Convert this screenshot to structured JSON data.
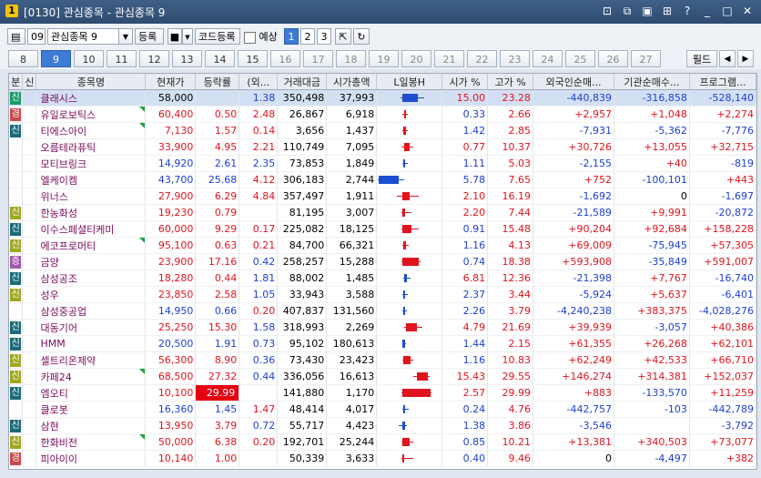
{
  "window": {
    "title": "[0130] 관심종목 - 관심종목 9",
    "app_badge": "1"
  },
  "toolbar": {
    "group_no": "09",
    "group_name": "관심종목 9",
    "register_label": "등록",
    "code_register_label": "코드등록",
    "forecast_label": "예상",
    "pages": [
      "1",
      "2",
      "3"
    ]
  },
  "tabs": [
    "8",
    "9",
    "10",
    "11",
    "12",
    "13",
    "14",
    "15",
    "16",
    "17",
    "18",
    "19",
    "20",
    "21",
    "22",
    "23",
    "24",
    "25",
    "26",
    "27"
  ],
  "active_tab": "9",
  "filter_label": "필드",
  "columns": [
    "분",
    "신",
    "종목명",
    "현재가",
    "등락률",
    "(외...",
    "거래대금",
    "시가총액",
    "L일봉H",
    "시가 %",
    "고가 %",
    "외국인순매...",
    "기관순매수...",
    "프로그램..."
  ],
  "colors": {
    "up": "#e0141e",
    "down": "#1c3fd6",
    "accent": "#3d7bd6"
  },
  "rows": [
    {
      "b": "신",
      "bc": "g",
      "name": "클래시스",
      "price": "58,000",
      "pc": "k",
      "chg": "",
      "cc": "k",
      "fr": "1.38",
      "fc": "b",
      "vol": "350,498",
      "cap": "37,993",
      "open": "15.00",
      "oc": "r",
      "high": "23.28",
      "hc": "r",
      "frn": "-440,839",
      "frc": "b",
      "inst": "-316,858",
      "ic": "b",
      "prog": "-528,140",
      "prc": "b",
      "flag": false,
      "candle": {
        "l": 26,
        "h": 52,
        "o": 28,
        "c": 45,
        "dir": "d"
      },
      "sel": true
    },
    {
      "b": "경",
      "bc": "r",
      "name": "유일로보틱스",
      "price": "60,400",
      "pc": "r",
      "chg": "0.50",
      "cc": "r",
      "fr": "2.48",
      "fc": "r",
      "vol": "26,867",
      "cap": "6,918",
      "open": "0.33",
      "oc": "b",
      "high": "2.66",
      "hc": "r",
      "frn": "+2,957",
      "frc": "r",
      "inst": "+1,048",
      "ic": "r",
      "prog": "+2,274",
      "prc": "r",
      "flag": true,
      "candle": {
        "l": 28,
        "h": 34,
        "o": 30,
        "c": 31,
        "dir": "u"
      }
    },
    {
      "b": "신",
      "bc": "t",
      "name": "티에스아이",
      "price": "7,130",
      "pc": "r",
      "chg": "1.57",
      "cc": "r",
      "fr": "0.14",
      "fc": "r",
      "vol": "3,656",
      "cap": "1,437",
      "open": "1.42",
      "oc": "b",
      "high": "2.85",
      "hc": "r",
      "frn": "-7,931",
      "frc": "b",
      "inst": "-5,362",
      "ic": "b",
      "prog": "-7,776",
      "prc": "b",
      "flag": true,
      "candle": {
        "l": 28,
        "h": 34,
        "o": 29,
        "c": 32,
        "dir": "u"
      }
    },
    {
      "b": "",
      "bc": "",
      "name": "오름테라퓨틱",
      "price": "33,900",
      "pc": "r",
      "chg": "4.95",
      "cc": "r",
      "fr": "2.21",
      "fc": "r",
      "vol": "110,749",
      "cap": "7,095",
      "open": "0.77",
      "oc": "r",
      "high": "10.37",
      "hc": "r",
      "frn": "+30,726",
      "frc": "r",
      "inst": "+13,055",
      "ic": "r",
      "prog": "+32,715",
      "prc": "r",
      "flag": false,
      "candle": {
        "l": 27,
        "h": 40,
        "o": 30,
        "c": 36,
        "dir": "u"
      }
    },
    {
      "b": "",
      "bc": "",
      "name": "모티브링크",
      "price": "14,920",
      "pc": "b",
      "chg": "2.61",
      "cc": "b",
      "fr": "2.35",
      "fc": "b",
      "vol": "73,853",
      "cap": "1,849",
      "open": "1.11",
      "oc": "b",
      "high": "5.03",
      "hc": "r",
      "frn": "-2,155",
      "frc": "b",
      "inst": "+40",
      "ic": "r",
      "prog": "-819",
      "prc": "b",
      "flag": false,
      "candle": {
        "l": 28,
        "h": 34,
        "o": 29,
        "c": 31,
        "dir": "d"
      }
    },
    {
      "b": "",
      "bc": "",
      "name": "엘케이켐",
      "price": "43,700",
      "pc": "b",
      "chg": "25.68",
      "cc": "b",
      "fr": "4.12",
      "fc": "r",
      "vol": "306,183",
      "cap": "2,744",
      "open": "5.78",
      "oc": "b",
      "high": "7.65",
      "hc": "r",
      "frn": "+752",
      "frc": "r",
      "inst": "-100,101",
      "ic": "b",
      "prog": "+443",
      "prc": "r",
      "flag": false,
      "candle": {
        "l": 1,
        "h": 30,
        "o": 2,
        "c": 24,
        "dir": "d"
      }
    },
    {
      "b": "",
      "bc": "",
      "name": "위너스",
      "price": "27,900",
      "pc": "r",
      "chg": "6.29",
      "cc": "r",
      "fr": "4.84",
      "fc": "r",
      "vol": "357,497",
      "cap": "1,911",
      "open": "2.10",
      "oc": "r",
      "high": "16.19",
      "hc": "r",
      "frn": "-1,692",
      "frc": "b",
      "inst": "0",
      "ic": "k",
      "prog": "-1,697",
      "prc": "b",
      "flag": false,
      "candle": {
        "l": 22,
        "h": 46,
        "o": 28,
        "c": 36,
        "dir": "u"
      }
    },
    {
      "b": "신",
      "bc": "y",
      "name": "한농화성",
      "price": "19,230",
      "pc": "r",
      "chg": "0.79",
      "cc": "r",
      "fr": "",
      "fc": "k",
      "vol": "81,195",
      "cap": "3,007",
      "open": "2.20",
      "oc": "r",
      "high": "7.44",
      "hc": "r",
      "frn": "-21,589",
      "frc": "b",
      "inst": "+9,991",
      "ic": "r",
      "prog": "-20,872",
      "prc": "b",
      "flag": false,
      "candle": {
        "l": 27,
        "h": 38,
        "o": 28,
        "c": 31,
        "dir": "u"
      }
    },
    {
      "b": "신",
      "bc": "t",
      "name": "이수스페셜티케미",
      "price": "60,000",
      "pc": "r",
      "chg": "9.29",
      "cc": "r",
      "fr": "0.17",
      "fc": "r",
      "vol": "225,082",
      "cap": "18,125",
      "open": "0.91",
      "oc": "b",
      "high": "15.48",
      "hc": "r",
      "frn": "+90,204",
      "frc": "r",
      "inst": "+92,684",
      "ic": "r",
      "prog": "+158,228",
      "prc": "r",
      "flag": false,
      "candle": {
        "l": 27,
        "h": 46,
        "o": 28,
        "c": 38,
        "dir": "u"
      }
    },
    {
      "b": "신",
      "bc": "y",
      "name": "에코프로머티",
      "price": "95,100",
      "pc": "r",
      "chg": "0.63",
      "cc": "r",
      "fr": "0.21",
      "fc": "r",
      "vol": "84,700",
      "cap": "66,321",
      "open": "1.16",
      "oc": "b",
      "high": "4.13",
      "hc": "r",
      "frn": "+69,009",
      "frc": "r",
      "inst": "-75,945",
      "ic": "b",
      "prog": "+57,305",
      "prc": "r",
      "flag": true,
      "candle": {
        "l": 28,
        "h": 35,
        "o": 29,
        "c": 32,
        "dir": "u"
      }
    },
    {
      "b": "증",
      "bc": "p",
      "name": "금양",
      "price": "23,900",
      "pc": "r",
      "chg": "17.16",
      "cc": "r",
      "fr": "0.42",
      "fc": "b",
      "vol": "258,257",
      "cap": "15,288",
      "open": "0.74",
      "oc": "b",
      "high": "18.38",
      "hc": "r",
      "frn": "+593,908",
      "frc": "r",
      "inst": "-35,849",
      "ic": "b",
      "prog": "+591,007",
      "prc": "r",
      "flag": false,
      "candle": {
        "l": 27,
        "h": 48,
        "o": 28,
        "c": 46,
        "dir": "u"
      }
    },
    {
      "b": "신",
      "bc": "t",
      "name": "삼성공조",
      "price": "18,280",
      "pc": "r",
      "chg": "0.44",
      "cc": "r",
      "fr": "1.81",
      "fc": "b",
      "vol": "88,002",
      "cap": "1,485",
      "open": "6.81",
      "oc": "r",
      "high": "12.36",
      "hc": "r",
      "frn": "-21,398",
      "frc": "b",
      "inst": "+7,767",
      "ic": "r",
      "prog": "-16,740",
      "prc": "b",
      "flag": false,
      "candle": {
        "l": 29,
        "h": 37,
        "o": 30,
        "c": 33,
        "dir": "d"
      }
    },
    {
      "b": "신",
      "bc": "y",
      "name": "성우",
      "price": "23,850",
      "pc": "r",
      "chg": "2.58",
      "cc": "r",
      "fr": "1.05",
      "fc": "b",
      "vol": "33,943",
      "cap": "3,588",
      "open": "2.37",
      "oc": "b",
      "high": "3.44",
      "hc": "r",
      "frn": "-5,924",
      "frc": "b",
      "inst": "+5,637",
      "ic": "r",
      "prog": "-6,401",
      "prc": "b",
      "flag": false,
      "candle": {
        "l": 28,
        "h": 34,
        "o": 29,
        "c": 31,
        "dir": "d"
      }
    },
    {
      "b": "",
      "bc": "",
      "name": "삼성중공업",
      "price": "14,950",
      "pc": "b",
      "chg": "0.66",
      "cc": "b",
      "fr": "0.20",
      "fc": "r",
      "vol": "407,837",
      "cap": "131,560",
      "open": "2.26",
      "oc": "b",
      "high": "3.79",
      "hc": "r",
      "frn": "-4,240,238",
      "frc": "b",
      "inst": "+383,375",
      "ic": "r",
      "prog": "-4,028,276",
      "prc": "b",
      "flag": false,
      "candle": {
        "l": 28,
        "h": 33,
        "o": 29,
        "c": 31,
        "dir": "d"
      }
    },
    {
      "b": "신",
      "bc": "t",
      "name": "대동기어",
      "price": "25,250",
      "pc": "r",
      "chg": "15.30",
      "cc": "r",
      "fr": "1.58",
      "fc": "b",
      "vol": "318,993",
      "cap": "2,269",
      "open": "4.79",
      "oc": "r",
      "high": "21.69",
      "hc": "r",
      "frn": "+39,939",
      "frc": "r",
      "inst": "-3,057",
      "ic": "b",
      "prog": "+40,386",
      "prc": "r",
      "flag": false,
      "candle": {
        "l": 30,
        "h": 50,
        "o": 32,
        "c": 44,
        "dir": "u"
      }
    },
    {
      "b": "신",
      "bc": "t",
      "name": "HMM",
      "price": "20,500",
      "pc": "b",
      "chg": "1.91",
      "cc": "b",
      "fr": "0.73",
      "fc": "b",
      "vol": "95,102",
      "cap": "180,613",
      "open": "1.44",
      "oc": "b",
      "high": "2.15",
      "hc": "r",
      "frn": "+61,355",
      "frc": "r",
      "inst": "+26,268",
      "ic": "r",
      "prog": "+62,101",
      "prc": "r",
      "flag": false,
      "candle": {
        "l": 28,
        "h": 32,
        "o": 28,
        "c": 31,
        "dir": "d"
      }
    },
    {
      "b": "신",
      "bc": "y",
      "name": "셀트리온제약",
      "price": "56,300",
      "pc": "r",
      "chg": "8.90",
      "cc": "r",
      "fr": "0.36",
      "fc": "b",
      "vol": "73,430",
      "cap": "23,423",
      "open": "1.16",
      "oc": "b",
      "high": "10.83",
      "hc": "r",
      "frn": "+62,249",
      "frc": "r",
      "inst": "+42,533",
      "ic": "r",
      "prog": "+66,710",
      "prc": "r",
      "flag": false,
      "candle": {
        "l": 28,
        "h": 40,
        "o": 29,
        "c": 37,
        "dir": "u"
      }
    },
    {
      "b": "신",
      "bc": "y",
      "name": "카페24",
      "price": "68,500",
      "pc": "r",
      "chg": "27.32",
      "cc": "r",
      "fr": "0.44",
      "fc": "b",
      "vol": "336,056",
      "cap": "16,613",
      "open": "15.43",
      "oc": "r",
      "high": "29.55",
      "hc": "r",
      "frn": "+146,274",
      "frc": "r",
      "inst": "+314,381",
      "ic": "r",
      "prog": "+152,037",
      "prc": "r",
      "flag": true,
      "candle": {
        "l": 40,
        "h": 58,
        "o": 44,
        "c": 56,
        "dir": "u"
      }
    },
    {
      "b": "신",
      "bc": "t",
      "name": "엠오티",
      "price": "10,100",
      "pc": "r",
      "chg": "29.99",
      "cc": "h",
      "fr": "",
      "fc": "k",
      "vol": "141,880",
      "cap": "1,170",
      "open": "2.57",
      "oc": "r",
      "high": "29.99",
      "hc": "r",
      "frn": "+883",
      "frc": "r",
      "inst": "-133,570",
      "ic": "b",
      "prog": "+11,259",
      "prc": "r",
      "flag": false,
      "candle": {
        "l": 27,
        "h": 60,
        "o": 28,
        "c": 59,
        "dir": "u"
      }
    },
    {
      "b": "",
      "bc": "",
      "name": "클로봇",
      "price": "16,360",
      "pc": "b",
      "chg": "1.45",
      "cc": "b",
      "fr": "1.47",
      "fc": "r",
      "vol": "48,414",
      "cap": "4,017",
      "open": "0.24",
      "oc": "b",
      "high": "4.76",
      "hc": "r",
      "frn": "-442,757",
      "frc": "b",
      "inst": "-103",
      "ic": "b",
      "prog": "-442,789",
      "prc": "b",
      "flag": false,
      "candle": {
        "l": 28,
        "h": 35,
        "o": 29,
        "c": 31,
        "dir": "d"
      }
    },
    {
      "b": "신",
      "bc": "t",
      "name": "삼현",
      "price": "13,950",
      "pc": "r",
      "chg": "3.79",
      "cc": "r",
      "fr": "0.72",
      "fc": "b",
      "vol": "55,717",
      "cap": "4,423",
      "open": "1.38",
      "oc": "b",
      "high": "3.86",
      "hc": "r",
      "frn": "-3,546",
      "frc": "b",
      "inst": "",
      "ic": "k",
      "prog": "-3,792",
      "prc": "b",
      "flag": false,
      "candle": {
        "l": 24,
        "h": 33,
        "o": 28,
        "c": 31,
        "dir": "d"
      }
    },
    {
      "b": "신",
      "bc": "y",
      "name": "한화비전",
      "price": "50,000",
      "pc": "r",
      "chg": "6.38",
      "cc": "r",
      "fr": "0.20",
      "fc": "r",
      "vol": "192,701",
      "cap": "25,244",
      "open": "0.85",
      "oc": "b",
      "high": "10.21",
      "hc": "r",
      "frn": "+13,381",
      "frc": "r",
      "inst": "+340,503",
      "ic": "r",
      "prog": "+73,077",
      "prc": "r",
      "flag": true,
      "candle": {
        "l": 27,
        "h": 40,
        "o": 28,
        "c": 36,
        "dir": "u"
      }
    },
    {
      "b": "경",
      "bc": "r",
      "name": "피아이이",
      "price": "10,140",
      "pc": "r",
      "chg": "1.00",
      "cc": "r",
      "fr": "",
      "fc": "k",
      "vol": "50,339",
      "cap": "3,633",
      "open": "0.40",
      "oc": "b",
      "high": "9.46",
      "hc": "r",
      "frn": "0",
      "frc": "k",
      "inst": "-4,497",
      "ic": "b",
      "prog": "+382",
      "prc": "r",
      "flag": false,
      "candle": {
        "l": 27,
        "h": 40,
        "o": 28,
        "c": 30,
        "dir": "u"
      }
    }
  ]
}
